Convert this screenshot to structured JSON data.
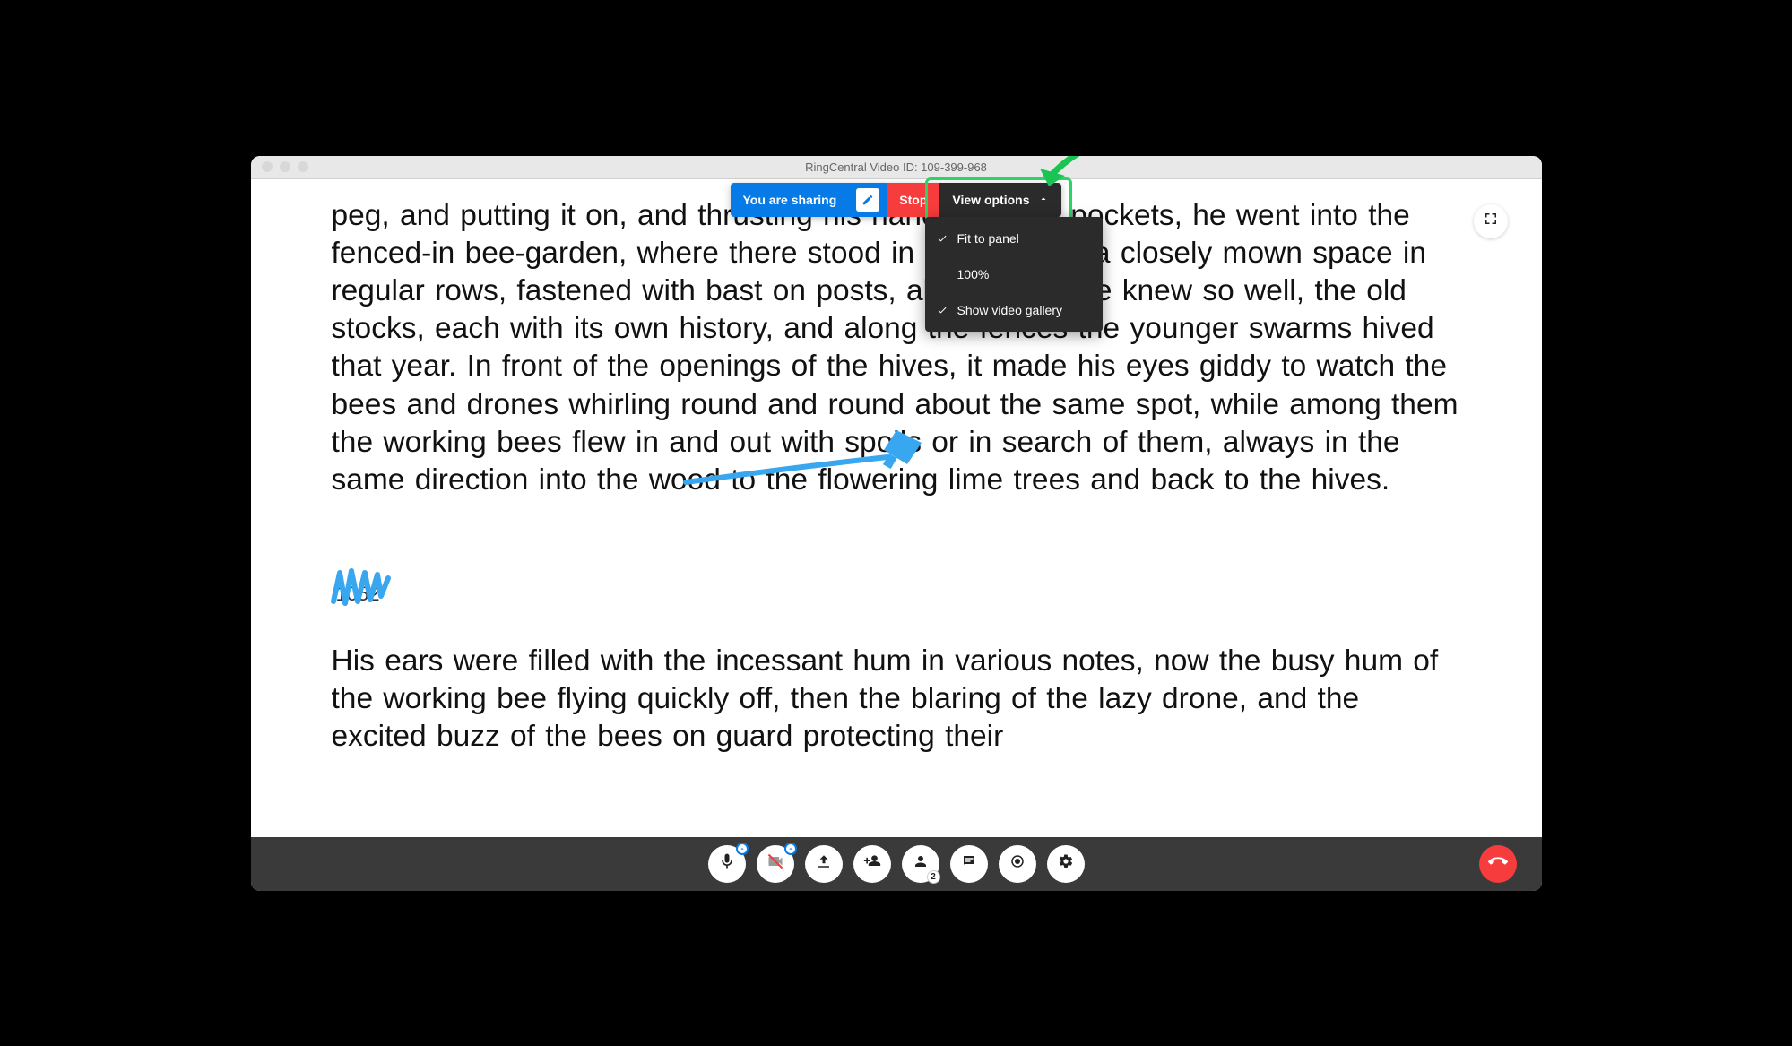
{
  "titlebar": {
    "title": "RingCentral Video ID: 109-399-968"
  },
  "topbar": {
    "sharing_label": "You are sharing",
    "stop_label": "Stop",
    "view_options_label": "View options"
  },
  "dropdown": {
    "items": [
      {
        "label": "Fit to panel",
        "checked": true
      },
      {
        "label": "100%",
        "checked": false
      },
      {
        "label": "Show video gallery",
        "checked": true
      }
    ]
  },
  "document": {
    "paragraph1": "peg, and putting it on, and thrusting his hands into his pockets, he went into the fenced-in bee-garden, where there stood in the midst of a closely mown space in regular rows, fastened with bast on posts, all the hives he knew so well, the old stocks, each with its own history, and along the fences the younger swarms hived that year. In front of the openings of the hives, it made his eyes giddy to watch the bees and drones whirling round and round about the same spot, while among them the working bees flew in and out with spoils or in search of them, always in the same direction into the wood to the flowering lime trees and back to the hives.",
    "page_number": "1052",
    "paragraph2": "His ears were filled with the incessant hum in various notes, now the busy hum of the working bee flying quickly off, then the blaring of the lazy drone, and the excited buzz of the bees on guard protecting their"
  },
  "bottombar": {
    "participants_count": "2"
  },
  "colors": {
    "accent_blue": "#067ae6",
    "stop_red": "#f63c3c",
    "highlight_green": "#2bd464",
    "annotation_blue": "#39a7f0"
  }
}
